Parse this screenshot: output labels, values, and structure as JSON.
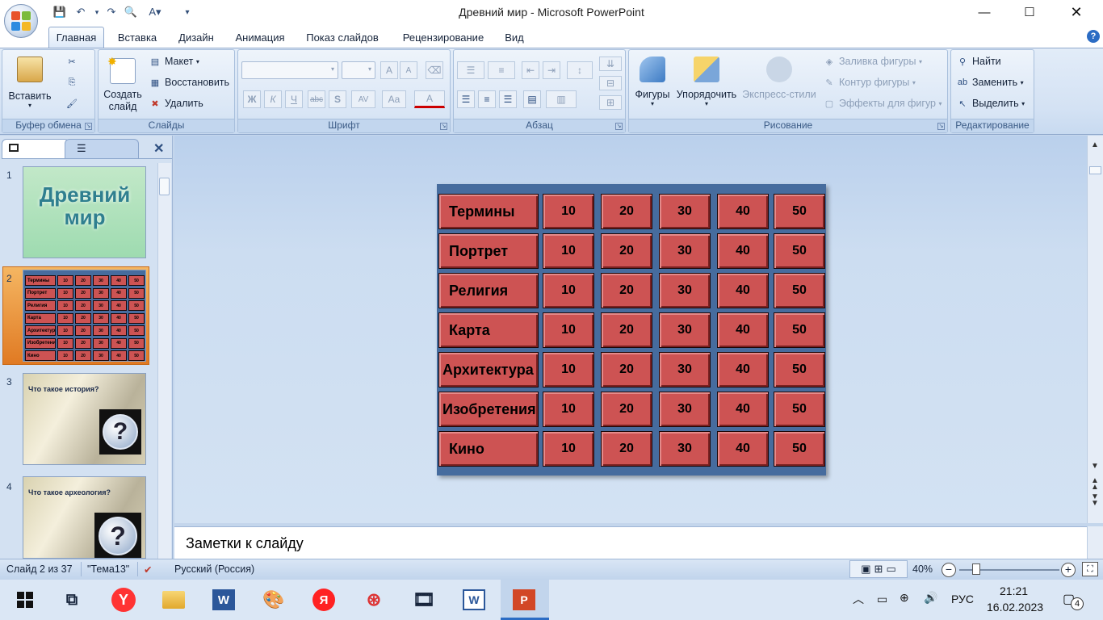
{
  "window": {
    "title": "Древний мир - Microsoft PowerPoint"
  },
  "tabs": [
    "Главная",
    "Вставка",
    "Дизайн",
    "Анимация",
    "Показ слайдов",
    "Рецензирование",
    "Вид"
  ],
  "ribbon": {
    "clipboard": {
      "label": "Буфер обмена",
      "paste": "Вставить"
    },
    "slides": {
      "label": "Слайды",
      "create": "Создать слайд",
      "layout": "Макет",
      "reset": "Восстановить",
      "delete": "Удалить"
    },
    "font": {
      "label": "Шрифт",
      "grow": "A",
      "shrink": "A",
      "bold": "Ж",
      "italic": "К",
      "underline": "Ч",
      "strike": "abc",
      "shadow": "S",
      "spacing": "AV",
      "case": "Aa",
      "color": "A"
    },
    "paragraph": {
      "label": "Абзац"
    },
    "drawing": {
      "label": "Рисование",
      "shapes": "Фигуры",
      "arrange": "Упорядочить",
      "quickstyles": "Экспресс-стили",
      "fill": "Заливка фигуры",
      "outline": "Контур фигуры",
      "effects": "Эффекты для фигур"
    },
    "editing": {
      "label": "Редактирование",
      "find": "Найти",
      "replace": "Заменить",
      "select": "Выделить"
    }
  },
  "thumbnails": [
    {
      "num": "1",
      "title": "Древний мир"
    },
    {
      "num": "2",
      "rows": [
        "Термины",
        "Портрет",
        "Религия",
        "Карта",
        "Архитектура",
        "Изобретения",
        "Кино"
      ]
    },
    {
      "num": "3",
      "question": "Что такое история?"
    },
    {
      "num": "4",
      "question": "Что такое археология?"
    }
  ],
  "slide": {
    "categories": [
      "Термины",
      "Портрет",
      "Религия",
      "Карта",
      "Архитектура",
      "Изобретения",
      "Кино"
    ],
    "points": [
      "10",
      "20",
      "30",
      "40",
      "50"
    ]
  },
  "notes": {
    "placeholder": "Заметки к слайду"
  },
  "status": {
    "slide": "Слайд 2 из 37",
    "theme": "\"Тема13\"",
    "language": "Русский (Россия)",
    "zoom": "40%",
    "zoom_level": 0.4
  },
  "taskbar": {
    "time": "21:21",
    "date": "16.02.2023",
    "lang": "РУС",
    "notifications": "4"
  },
  "colors": {
    "cell": "#cd5353",
    "slide_bg": "#466c9e",
    "accent": "#2b579a"
  }
}
